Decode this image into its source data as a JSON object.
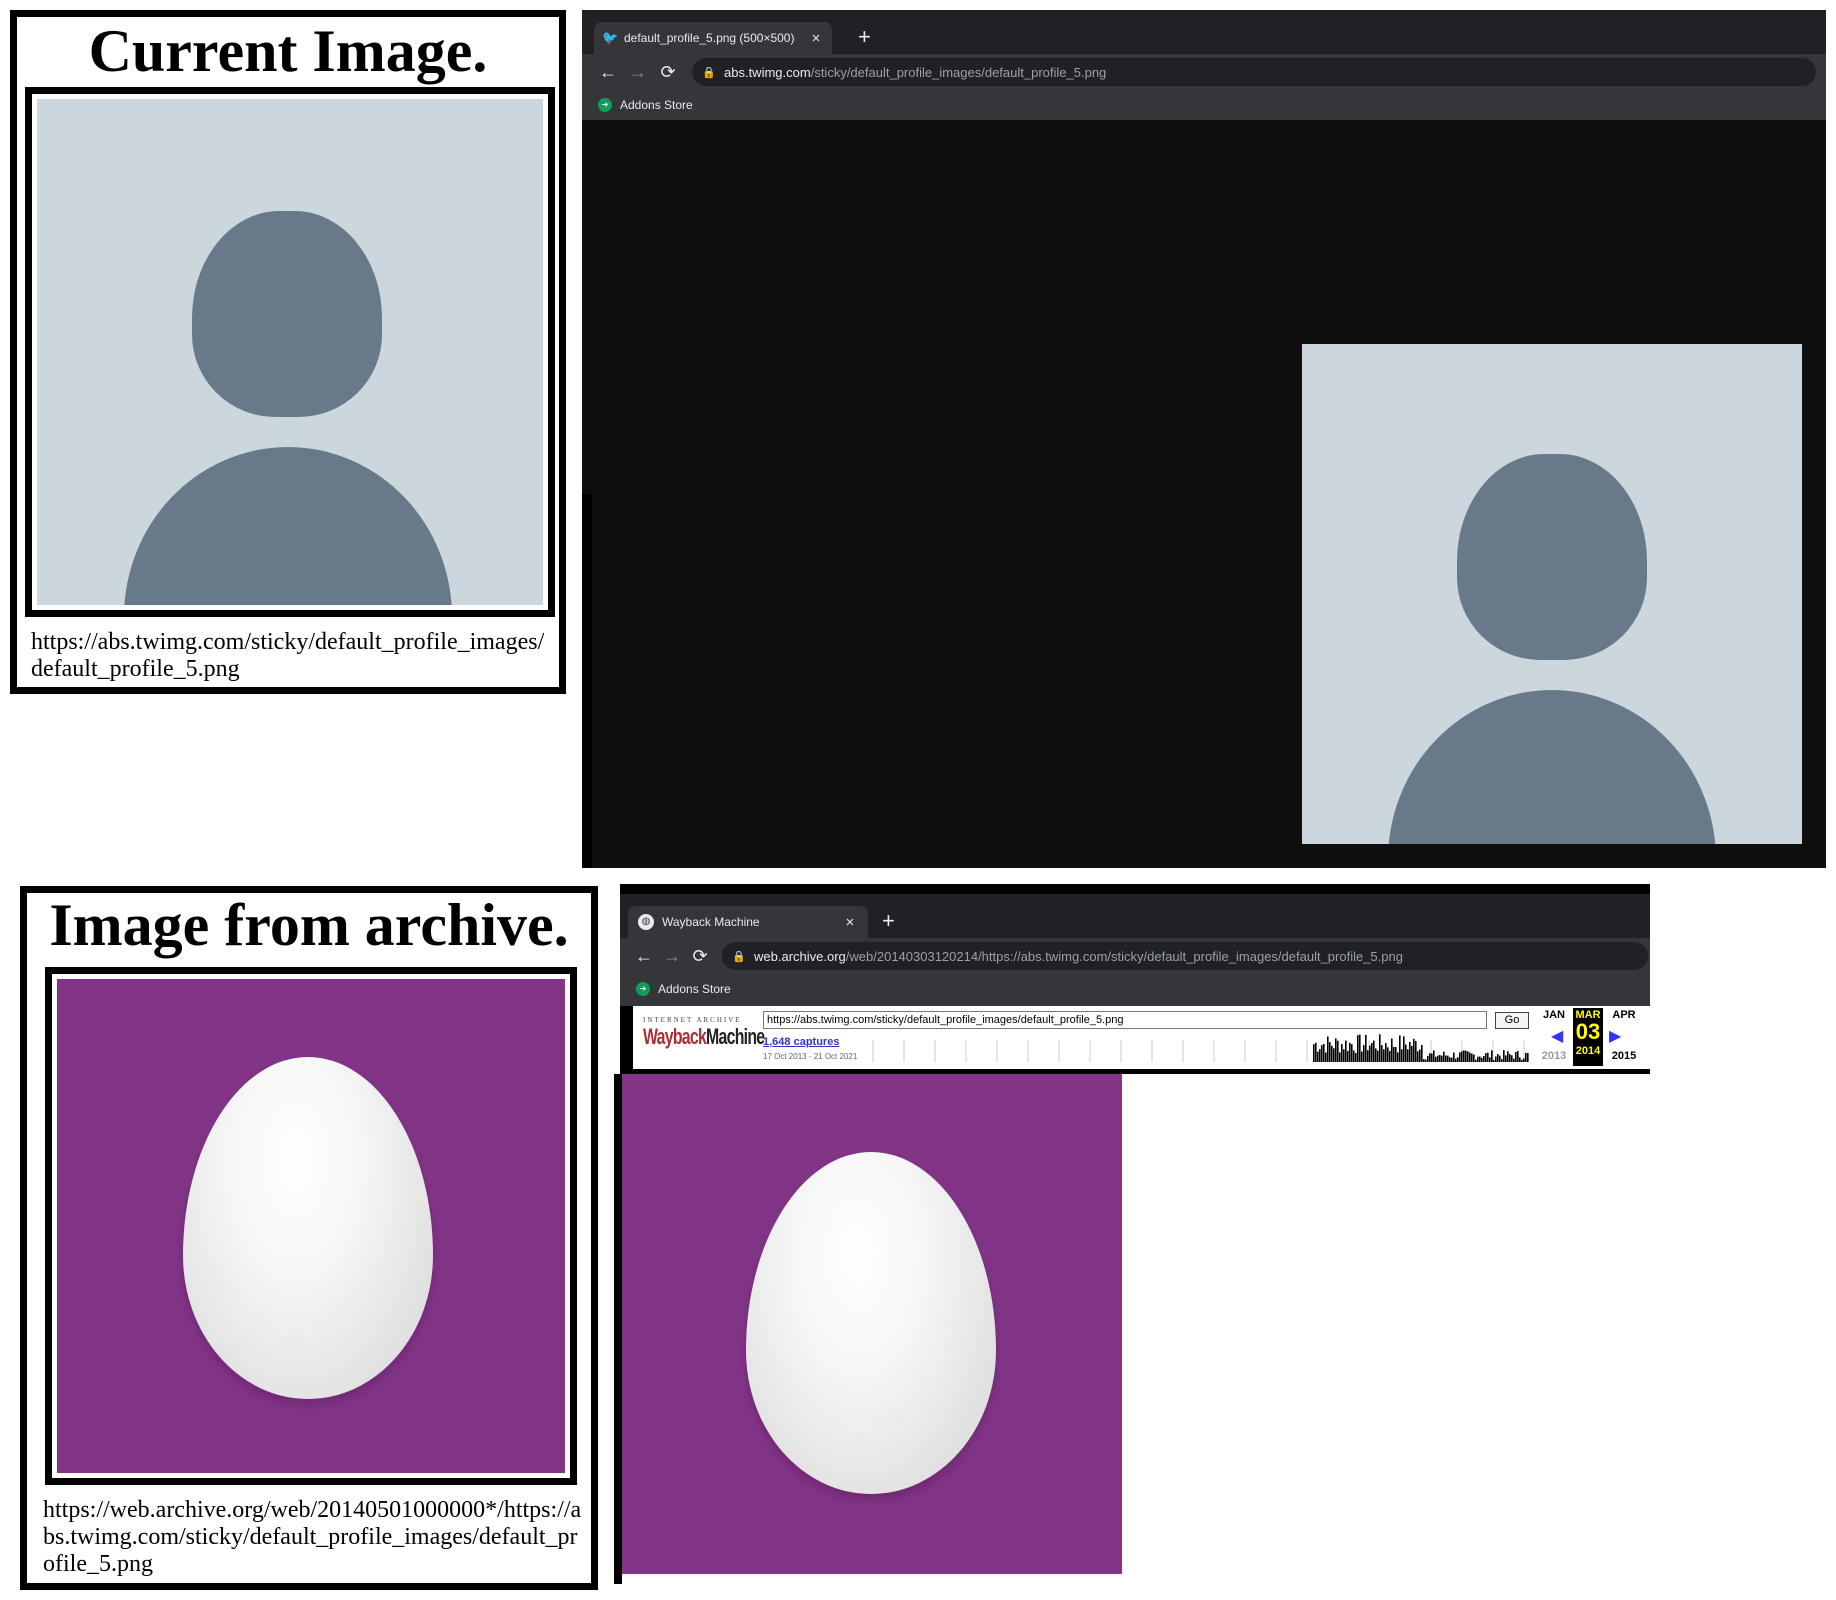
{
  "current_card": {
    "title": "Current Image.",
    "url": "https://abs.twimg.com/sticky/default_profile_images/default_profile_5.png"
  },
  "archive_card": {
    "title": "Image from archive.",
    "url": "https://web.archive.org/web/20140501000000*/https://abs.twimg.com/sticky/default_profile_images/default_profile_5.png"
  },
  "browser_current": {
    "tab_title": "default_profile_5.png (500×500)",
    "tab_icon": "twitter-bird-icon",
    "new_tab": "+",
    "close": "×",
    "url_host": "abs.twimg.com",
    "url_path": "/sticky/default_profile_images/default_profile_5.png",
    "bookmark": "Addons Store",
    "back": "←",
    "forward": "→",
    "reload": "⟳"
  },
  "browser_archive": {
    "tab_title": "Wayback Machine",
    "tab_icon": "globe-icon",
    "new_tab": "+",
    "close": "×",
    "url_host": "web.archive.org",
    "url_path": "/web/20140303120214/https://abs.twimg.com/sticky/default_profile_images/default_profile_5.png",
    "bookmark": "Addons Store",
    "back": "←",
    "forward": "→",
    "reload": "⟳"
  },
  "wayback": {
    "logo_top": "INTERNET ARCHIVE",
    "logo_wayback": "Wayback",
    "logo_machine": "Machine",
    "url_value": "https://abs.twimg.com/sticky/default_profile_images/default_profile_5.png",
    "go_label": "Go",
    "captures": "1,648 captures",
    "range": "17 Oct 2013 - 21 Oct 2021",
    "prev_month": "JAN",
    "cur_month": "MAR",
    "next_month": "APR",
    "cur_day": "03",
    "prev_year": "2013",
    "cur_year": "2014",
    "next_year": "2015",
    "prev_arrow": "◀",
    "next_arrow": "▶"
  },
  "colors": {
    "avatar_bg": "#cbd6dd",
    "avatar_fg": "#687a8a",
    "egg_bg": "#823587",
    "chrome_dark": "#202124",
    "chrome_mid": "#35363a"
  }
}
